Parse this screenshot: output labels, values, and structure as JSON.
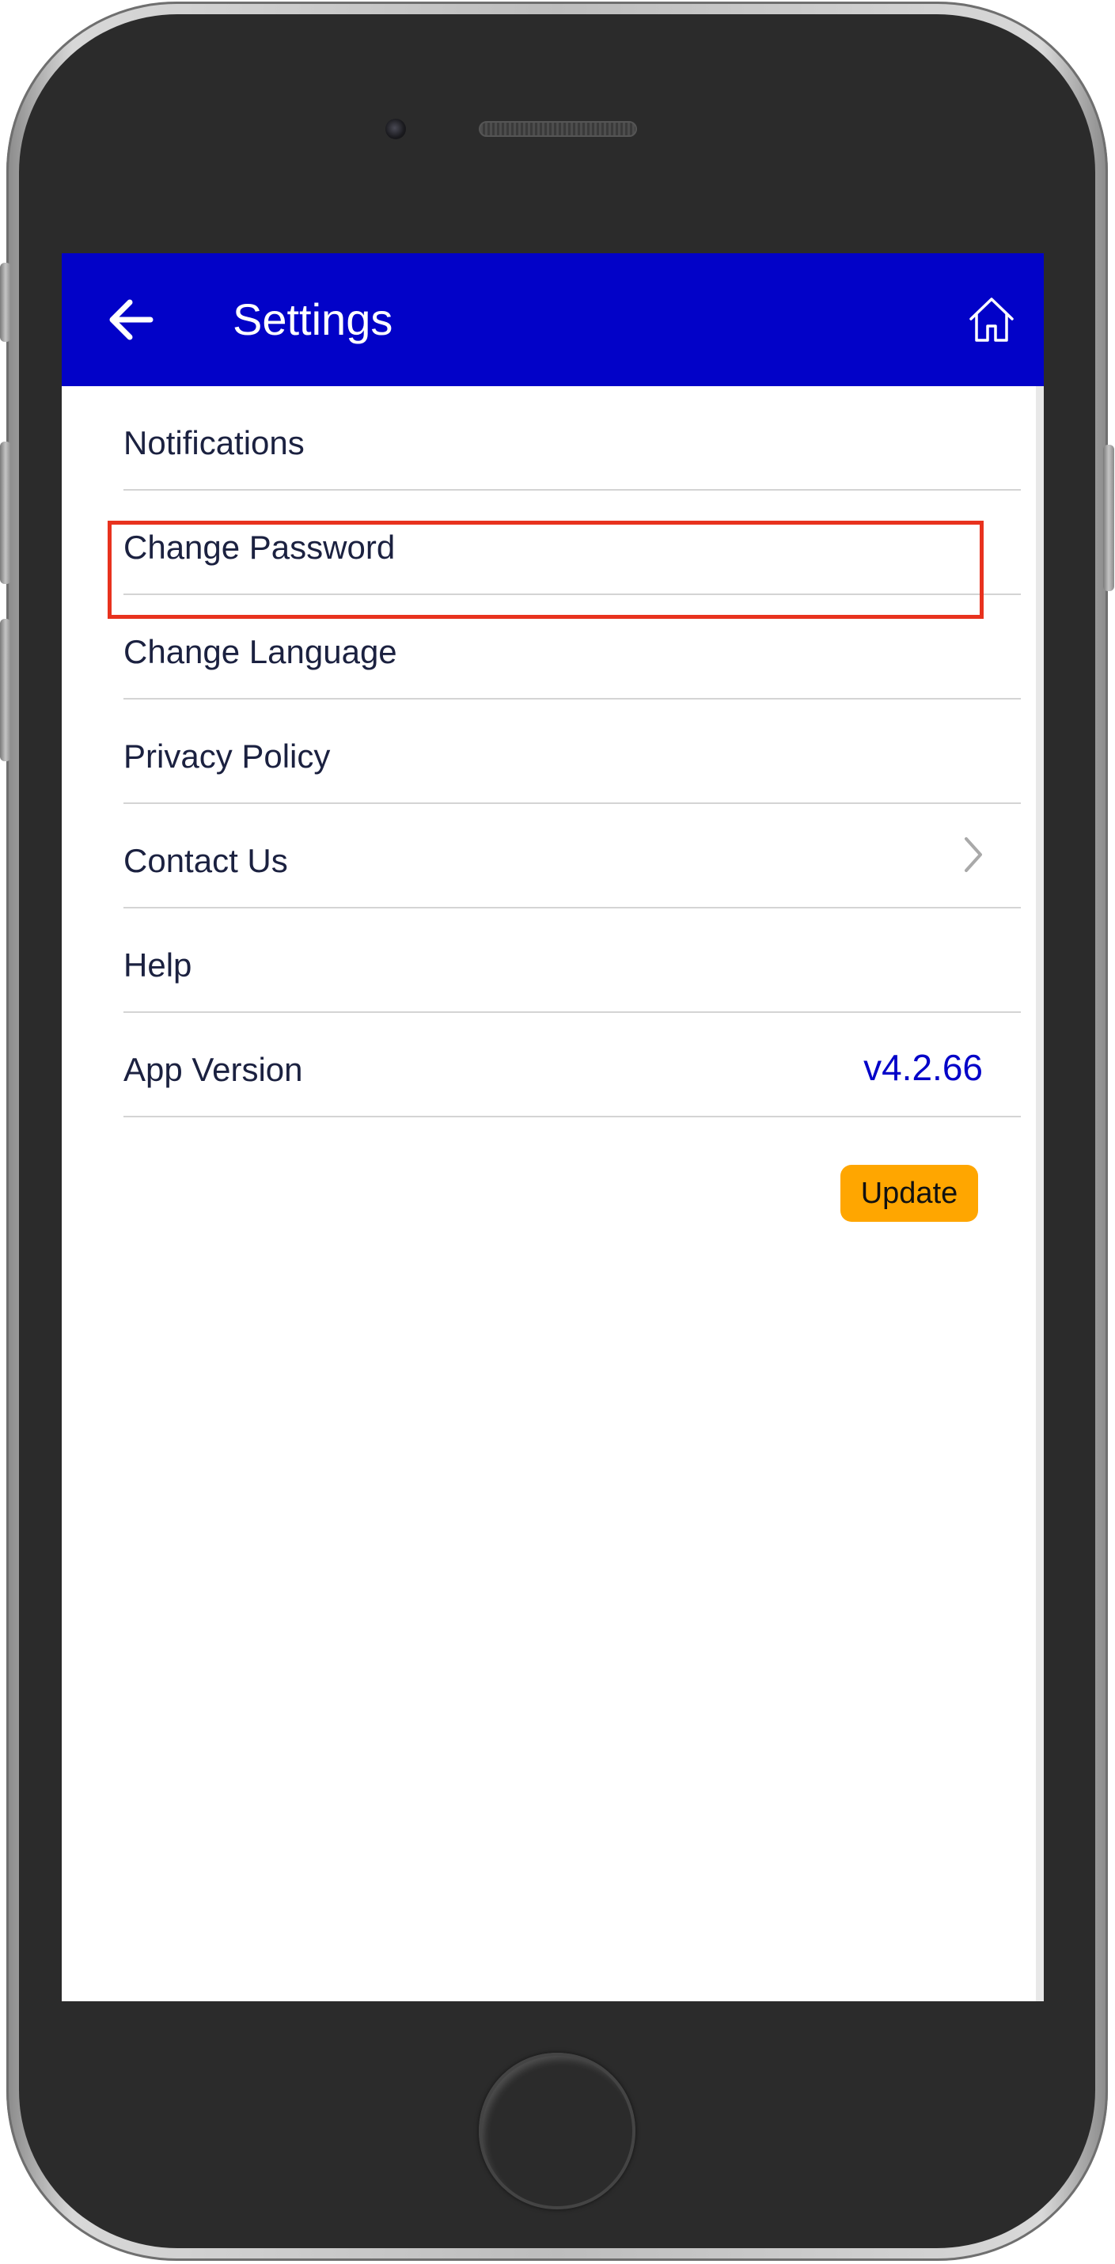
{
  "header": {
    "title": "Settings",
    "back_icon": "arrow-left-icon",
    "home_icon": "home-icon",
    "background_color": "#0202c8"
  },
  "settings": {
    "items": [
      {
        "label": "Notifications"
      },
      {
        "label": "Change Password",
        "highlighted": true
      },
      {
        "label": "Change Language"
      },
      {
        "label": "Privacy Policy"
      },
      {
        "label": "Contact Us",
        "trailing_icon": "chevron-right-icon"
      },
      {
        "label": "Help"
      },
      {
        "label": "App Version",
        "value": "v4.2.66"
      }
    ]
  },
  "update": {
    "label": "Update",
    "color": "#ffa600"
  },
  "highlight_color": "#e8321e"
}
